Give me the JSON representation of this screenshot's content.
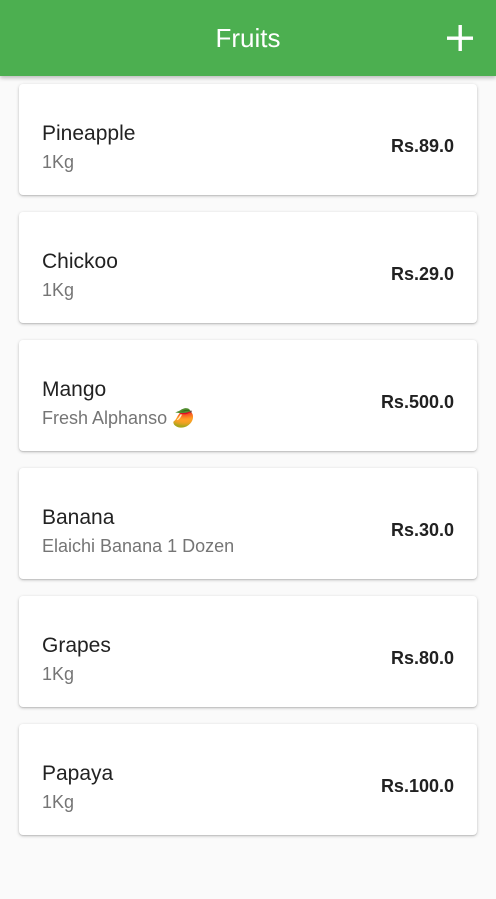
{
  "app_bar": {
    "title": "Fruits",
    "add_icon": "plus-icon",
    "color": "#4caf50"
  },
  "fruits": [
    {
      "name": "Pineapple",
      "description": "1Kg",
      "price": "Rs.89.0"
    },
    {
      "name": "Chickoo",
      "description": "1Kg",
      "price": "Rs.29.0"
    },
    {
      "name": "Mango",
      "description": "Fresh Alphanso 🥭",
      "price": "Rs.500.0"
    },
    {
      "name": "Banana",
      "description": "Elaichi Banana 1 Dozen",
      "price": "Rs.30.0"
    },
    {
      "name": "Grapes",
      "description": "1Kg",
      "price": "Rs.80.0"
    },
    {
      "name": "Papaya",
      "description": "1Kg",
      "price": "Rs.100.0"
    }
  ]
}
